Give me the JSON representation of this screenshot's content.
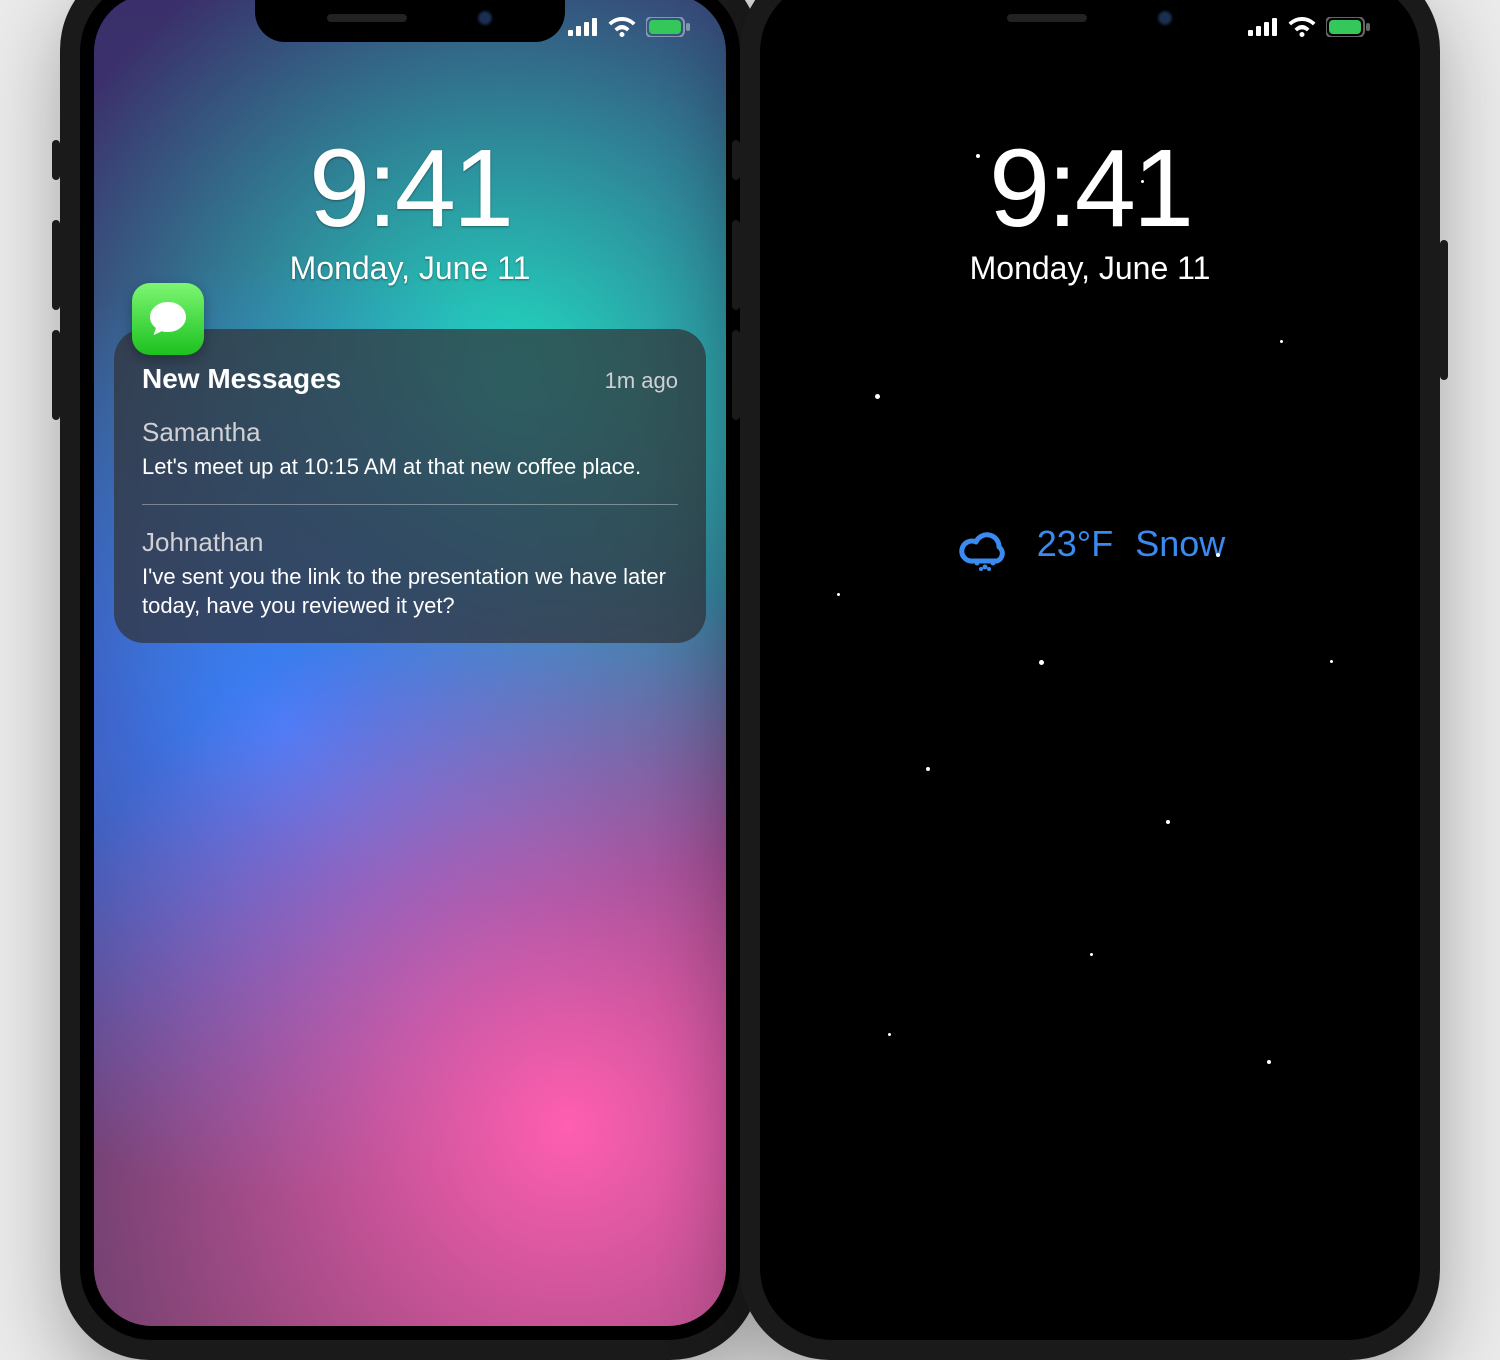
{
  "time": "9:41",
  "date": "Monday, June 11",
  "notification": {
    "title": "New Messages",
    "timestamp": "1m ago",
    "messages": [
      {
        "sender": "Samantha",
        "body": "Let's meet up at  10:15 AM at that new coffee place."
      },
      {
        "sender": "Johnathan",
        "body": "I've sent you the link to the presentation we have later today, have you reviewed it yet?"
      }
    ]
  },
  "weather": {
    "temp": "23°F",
    "condition": "Snow"
  }
}
